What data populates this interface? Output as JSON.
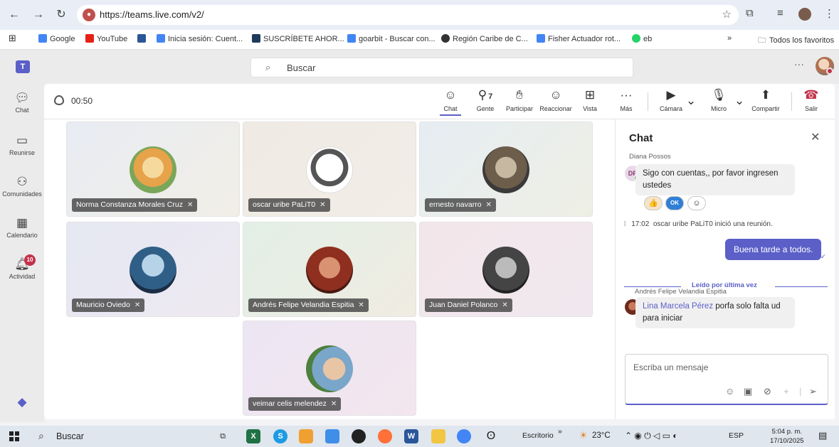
{
  "browser": {
    "url": "https://teams.live.com/v2/",
    "bookmarks": [
      {
        "label": "Google",
        "color": "#4285f4"
      },
      {
        "label": "YouTube",
        "color": "#e62117"
      },
      {
        "label": "",
        "color": "#2b5797"
      },
      {
        "label": "Inicia sesión: Cuent...",
        "color": "#4285f4"
      },
      {
        "label": "SUSCRÍBETE AHOR...",
        "color": "#1f3a5a"
      },
      {
        "label": "goarbit - Buscar con...",
        "color": "#4285f4"
      },
      {
        "label": "Región Caribe de C...",
        "color": "#333333"
      },
      {
        "label": "Fisher Actuador rot...",
        "color": "#4285f4"
      },
      {
        "label": "eb",
        "color": "#25d366"
      }
    ],
    "more_bookmarks": "»",
    "all_favorites": "Todos los favoritos"
  },
  "teams": {
    "search_placeholder": "Buscar",
    "rail": [
      {
        "label": "Chat",
        "icon": "chat-icon"
      },
      {
        "label": "Reunirse",
        "icon": "camera-icon"
      },
      {
        "label": "Comunidades",
        "icon": "communities-icon"
      },
      {
        "label": "Calendario",
        "icon": "calendar-icon"
      },
      {
        "label": "Actividad",
        "icon": "bell-icon",
        "badge": "10"
      }
    ]
  },
  "meeting": {
    "timer": "00:50",
    "toolbar": {
      "chat": "Chat",
      "people": "Gente",
      "people_count": "7",
      "raise": "Participar",
      "react": "Reaccionar",
      "view": "Vista",
      "more": "Más",
      "camera": "Cámara",
      "mic": "Micro",
      "share": "Compartir",
      "leave": "Salir"
    },
    "participants": [
      "Norma Constanza Morales Cruz",
      "oscar uribe PaLiT0",
      "ernesto navarro",
      "Mauricio Oviedo",
      "Andrés Felipe Velandia Espitia",
      "Juan Daniel Polanco",
      "veimar celis melendez"
    ]
  },
  "chat": {
    "title": "Chat",
    "msg1_sender": "Diana Possos",
    "msg1_initials": "DP",
    "msg1_text": "Sigo con cuentas,, por favor ingresen ustedes",
    "reactions": [
      "👍",
      "OK",
      "☺"
    ],
    "system_time": "17:02",
    "system_text": "oscar uribe PaLiT0 inició una reunión.",
    "own_msg": "Buena tarde a todos.",
    "last_read": "Leído por última vez",
    "msg2_sender": "Andrés Felipe Velandia Espitia",
    "msg2_mention": "Lina Marcela Pérez",
    "msg2_text": " porfa solo falta ud para iniciar",
    "compose_placeholder": "Escriba un mensaje"
  },
  "taskbar": {
    "search": "Buscar",
    "desktop": "Escritorio",
    "weather": "23°C",
    "lang": "ESP",
    "time": "5:04 p. m.",
    "date": "17/10/2025"
  },
  "colors": {
    "teams_accent": "#5b5fc7",
    "leave": "#c4314b"
  }
}
